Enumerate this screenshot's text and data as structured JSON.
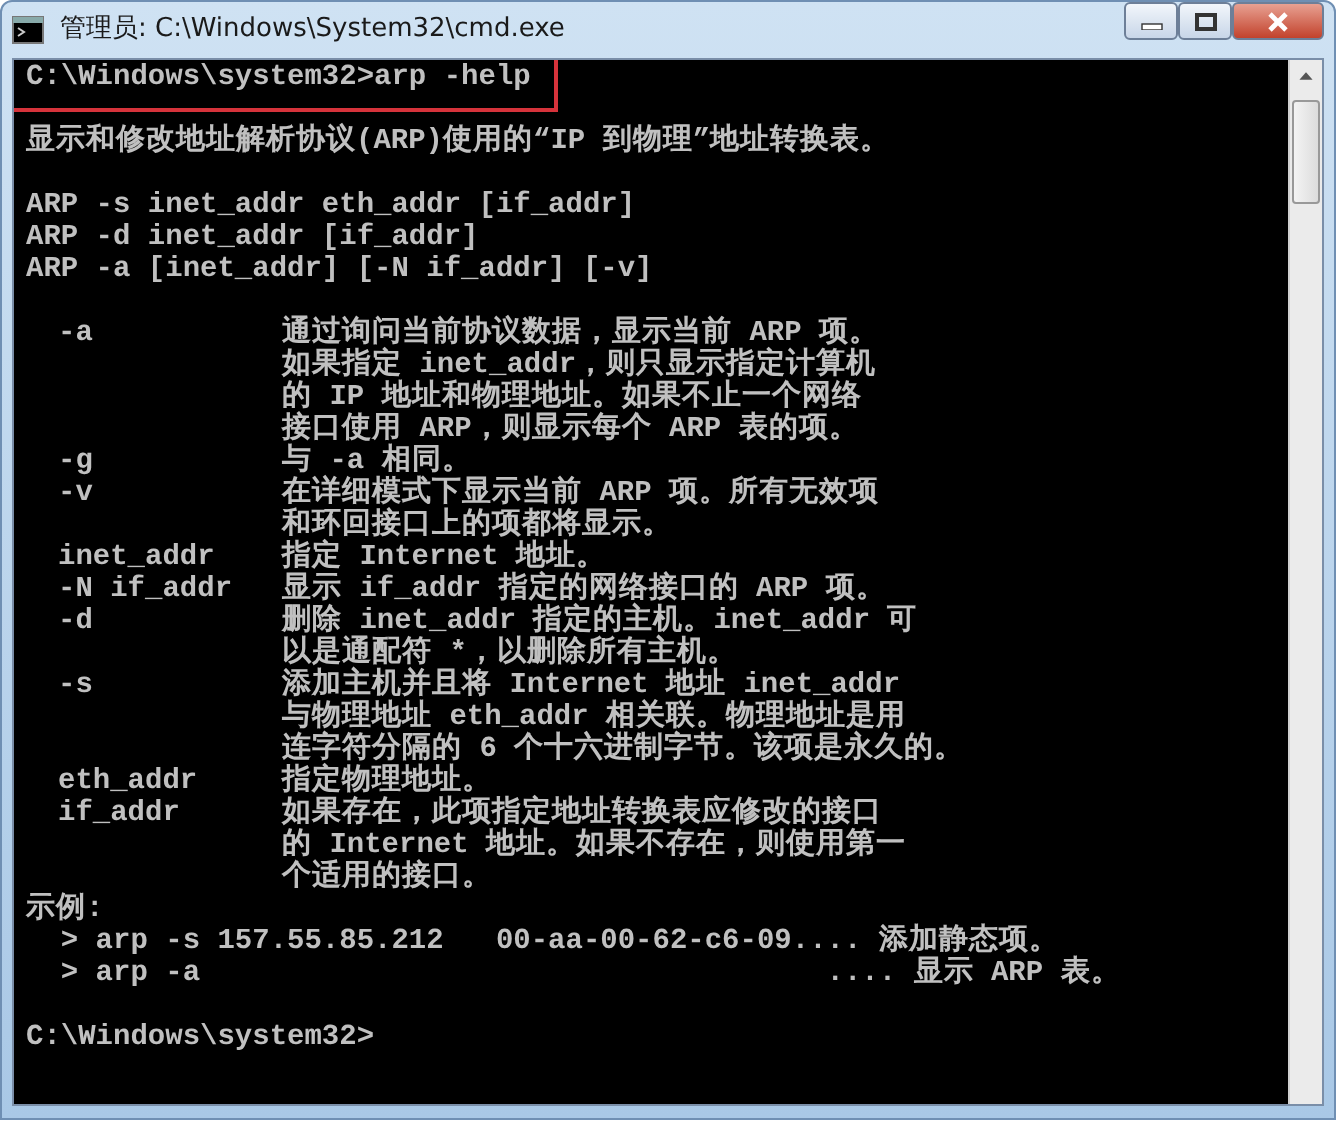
{
  "window": {
    "title": "管理员: C:\\Windows\\System32\\cmd.exe"
  },
  "console": {
    "lines": [
      {
        "kind": "prompt",
        "text": "C:\\Windows\\system32>arp -help",
        "highlighted": true
      },
      {
        "kind": "blank"
      },
      {
        "kind": "output",
        "text": "显示和修改地址解析协议(ARP)使用的“IP 到物理”地址转换表。"
      },
      {
        "kind": "blank"
      },
      {
        "kind": "output",
        "text": "ARP -s inet_addr eth_addr [if_addr]"
      },
      {
        "kind": "output",
        "text": "ARP -d inet_addr [if_addr]"
      },
      {
        "kind": "output",
        "text": "ARP -a [inet_addr] [-N if_addr] [-v]"
      },
      {
        "kind": "blank"
      },
      {
        "kind": "option",
        "flag": "-a",
        "text": "通过询问当前协议数据，显示当前 ARP 项。"
      },
      {
        "kind": "option",
        "text": "如果指定 inet_addr，则只显示指定计算机"
      },
      {
        "kind": "option",
        "text": "的 IP 地址和物理地址。如果不止一个网络"
      },
      {
        "kind": "option",
        "text": "接口使用 ARP，则显示每个 ARP 表的项。"
      },
      {
        "kind": "option",
        "flag": "-g",
        "text": "与 -a 相同。"
      },
      {
        "kind": "option",
        "flag": "-v",
        "text": "在详细模式下显示当前 ARP 项。所有无效项"
      },
      {
        "kind": "option",
        "text": "和环回接口上的项都将显示。"
      },
      {
        "kind": "option",
        "flag": "inet_addr",
        "text": "指定 Internet 地址。"
      },
      {
        "kind": "option",
        "flag": "-N if_addr",
        "text": "显示 if_addr 指定的网络接口的 ARP 项。"
      },
      {
        "kind": "option",
        "flag": "-d",
        "text": "删除 inet_addr 指定的主机。inet_addr 可"
      },
      {
        "kind": "option",
        "text": "以是通配符 *，以删除所有主机。"
      },
      {
        "kind": "option",
        "flag": "-s",
        "text": "添加主机并且将 Internet 地址 inet_addr"
      },
      {
        "kind": "option",
        "text": "与物理地址 eth_addr 相关联。物理地址是用"
      },
      {
        "kind": "option",
        "text": "连字符分隔的 6 个十六进制字节。该项是永久的。"
      },
      {
        "kind": "option",
        "flag": "eth_addr",
        "text": "指定物理地址。"
      },
      {
        "kind": "option",
        "flag": "if_addr",
        "text": "如果存在，此项指定地址转换表应修改的接口"
      },
      {
        "kind": "option",
        "text": "的 Internet 地址。如果不存在，则使用第一"
      },
      {
        "kind": "option",
        "text": "个适用的接口。"
      },
      {
        "kind": "output",
        "text": "示例:"
      },
      {
        "kind": "output",
        "text": "  > arp -s 157.55.85.212   00-aa-00-62-c6-09.... 添加静态项。"
      },
      {
        "kind": "output",
        "text": "  > arp -a                                    .... 显示 ARP 表。"
      },
      {
        "kind": "blank"
      },
      {
        "kind": "prompt",
        "text": "C:\\Windows\\system32>",
        "highlighted": false
      }
    ]
  }
}
